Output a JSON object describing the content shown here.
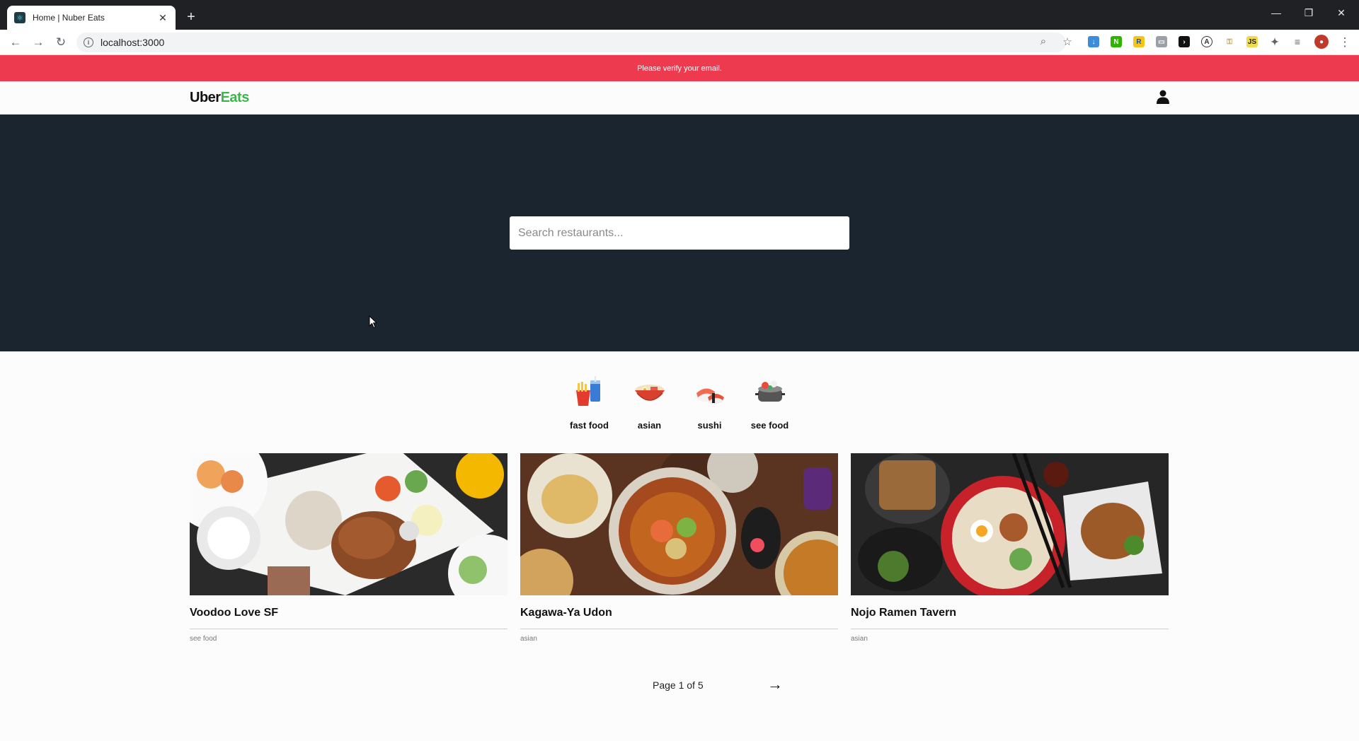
{
  "browser": {
    "tab_title": "Home | Nuber Eats",
    "url": "localhost:3000",
    "new_tab_label": "+",
    "close_tab_label": "✕"
  },
  "banner": {
    "text": "Please verify your email."
  },
  "header": {
    "logo_left": "Uber",
    "logo_right": "Eats",
    "brand_green": "#3bb64a"
  },
  "search": {
    "placeholder": "Search restaurants..."
  },
  "categories": [
    {
      "label": "fast food",
      "icon": "fast-food-icon"
    },
    {
      "label": "asian",
      "icon": "noodle-bowl-icon"
    },
    {
      "label": "sushi",
      "icon": "sushi-icon"
    },
    {
      "label": "see food",
      "icon": "seafood-pot-icon"
    }
  ],
  "restaurants": [
    {
      "name": "Voodoo Love SF",
      "category": "see food"
    },
    {
      "name": "Kagawa-Ya Udon",
      "category": "asian"
    },
    {
      "name": "Nojo Ramen Tavern",
      "category": "asian"
    }
  ],
  "pagination": {
    "text": "Page 1 of 5",
    "next_label": "→"
  },
  "colors": {
    "banner": "#ee3a4f",
    "hero": "#1b2530"
  }
}
